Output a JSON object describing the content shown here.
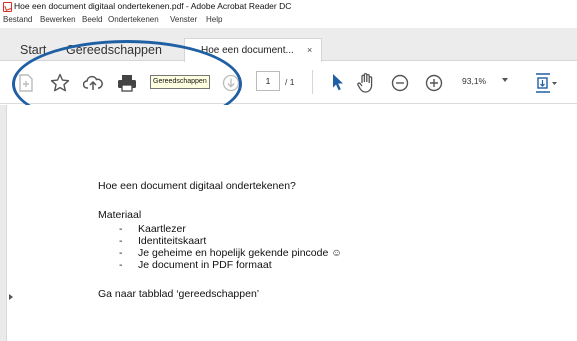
{
  "window": {
    "title": "Hoe een document digitaal ondertekenen.pdf - Adobe Acrobat Reader DC"
  },
  "menu": {
    "items": [
      "Bestand",
      "Bewerken",
      "Beeld",
      "Ondertekenen",
      "Venster",
      "Help"
    ]
  },
  "tabs": {
    "start": "Start",
    "tools": "Gereedschappen",
    "document": "Hoe een document...",
    "close": "×"
  },
  "toolbar": {
    "tooltip": "Gereedschappen",
    "page_current": "1",
    "page_total": "/ 1",
    "zoom": "93,1%"
  },
  "icons": {
    "app": "acrobat-icon",
    "create": "create-pdf-icon",
    "bookmark": "star-icon",
    "upload": "cloud-upload-icon",
    "print": "printer-icon",
    "download": "download-icon",
    "select": "cursor-icon",
    "hand": "hand-icon",
    "zoom_out": "zoom-out-icon",
    "zoom_in": "zoom-in-icon",
    "fit": "fit-page-icon"
  },
  "colors": {
    "annotation": "#1f5fa3",
    "tooltip_bg": "#ffffe1",
    "app_red": "#d93025"
  },
  "document": {
    "heading": "Hoe een document digitaal ondertekenen?",
    "material_label": "Materiaal",
    "items": [
      "Kaartlezer",
      "Identiteitskaart",
      "Je geheime en hopelijk gekende pincode ☺",
      "Je document in PDF formaat"
    ],
    "bullet": "-",
    "instruction": "Ga naar tabblad ‘gereedschappen’"
  }
}
